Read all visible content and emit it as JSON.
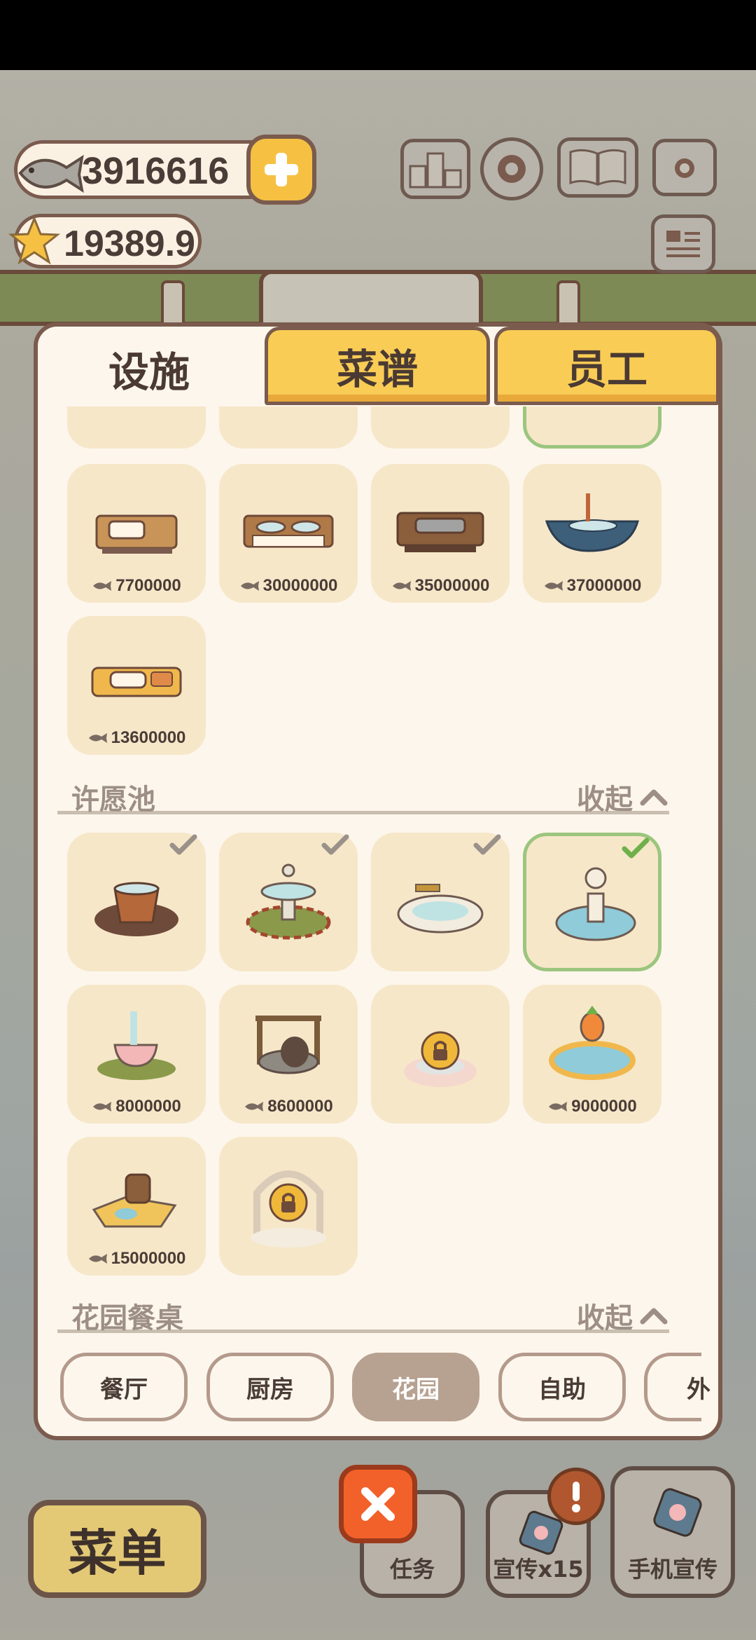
{
  "currency": {
    "fish": "3916616",
    "stars": "19389.9"
  },
  "tabs": [
    {
      "label": "设施",
      "active": true
    },
    {
      "label": "菜谱",
      "active": false
    },
    {
      "label": "员工",
      "active": false
    }
  ],
  "sections": {
    "sink_row": {
      "prices": [
        "7700000",
        "30000000",
        "35000000",
        "37000000",
        "13600000"
      ]
    },
    "wishing_pool": {
      "title": "许愿池",
      "collapse_label": "收起",
      "prices": [
        "8000000",
        "8600000",
        "9000000",
        "15000000"
      ]
    },
    "garden_table": {
      "title": "花园餐桌",
      "collapse_label": "收起"
    }
  },
  "categories": [
    "餐厅",
    "厨房",
    "花园",
    "自助",
    "外"
  ],
  "active_category": "花园",
  "bottom": {
    "menu_label": "菜单",
    "tasks_label": "任务",
    "promo_label": "宣传x15",
    "phone_promo_label": "手机宣传"
  },
  "icons": {
    "fish": "fish-icon",
    "star": "star-icon",
    "plus": "plus-icon",
    "lock": "lock-icon",
    "check": "check-icon",
    "chevron": "chevron-up-icon",
    "close": "close-icon",
    "alert": "exclamation-icon"
  },
  "colors": {
    "tab_yellow": "#f9cc55",
    "card_bg": "#f6e7c9",
    "selected_border": "#9cc57e",
    "close_orange": "#f2612a"
  }
}
